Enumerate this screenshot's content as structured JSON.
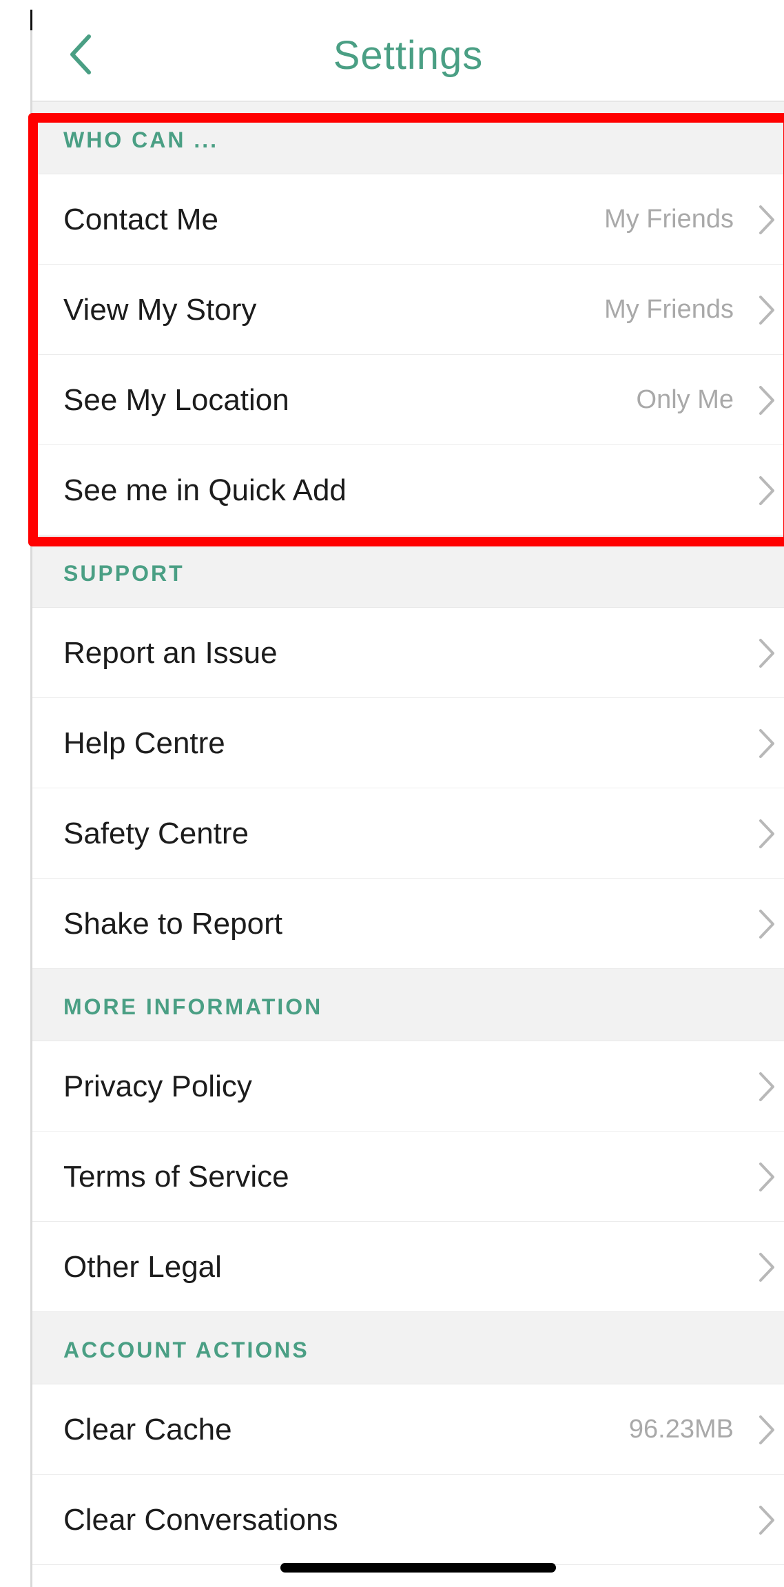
{
  "header": {
    "title": "Settings",
    "back_icon": "chevron-left-icon"
  },
  "colors": {
    "accent": "#4a9f84",
    "section_bg": "#f2f2f2",
    "value_text": "#a9a9a9",
    "highlight": "#ff0000"
  },
  "sections": [
    {
      "header": "WHO CAN ...",
      "rows": [
        {
          "label": "Contact Me",
          "value": "My Friends"
        },
        {
          "label": "View My Story",
          "value": "My Friends"
        },
        {
          "label": "See My Location",
          "value": "Only Me"
        },
        {
          "label": "See me in Quick Add",
          "value": ""
        }
      ]
    },
    {
      "header": "SUPPORT",
      "rows": [
        {
          "label": "Report an Issue",
          "value": ""
        },
        {
          "label": "Help Centre",
          "value": ""
        },
        {
          "label": "Safety Centre",
          "value": ""
        },
        {
          "label": "Shake to Report",
          "value": ""
        }
      ]
    },
    {
      "header": "MORE INFORMATION",
      "rows": [
        {
          "label": "Privacy Policy",
          "value": ""
        },
        {
          "label": "Terms of Service",
          "value": ""
        },
        {
          "label": "Other Legal",
          "value": ""
        }
      ]
    },
    {
      "header": "ACCOUNT ACTIONS",
      "rows": [
        {
          "label": "Clear Cache",
          "value": "96.23MB"
        },
        {
          "label": "Clear Conversations",
          "value": ""
        }
      ]
    }
  ]
}
